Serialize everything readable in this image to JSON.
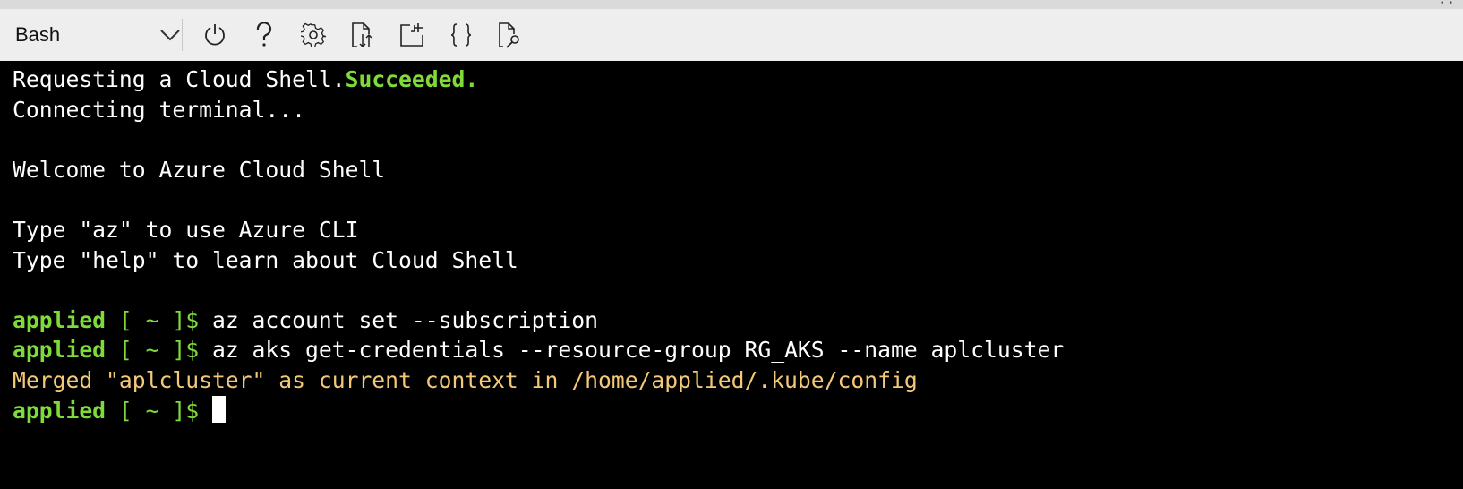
{
  "toolbar": {
    "shell_selector": {
      "selected": "Bash"
    },
    "buttons": [
      {
        "name": "restart",
        "icon": "power-icon"
      },
      {
        "name": "help",
        "icon": "question-icon"
      },
      {
        "name": "settings",
        "icon": "gear-icon"
      },
      {
        "name": "upload-download",
        "icon": "file-transfer-icon"
      },
      {
        "name": "new-session",
        "icon": "new-window-icon"
      },
      {
        "name": "editor",
        "icon": "braces-icon"
      },
      {
        "name": "web-preview",
        "icon": "file-search-icon"
      }
    ]
  },
  "terminal": {
    "colors": {
      "prompt": "#7ddc3a",
      "success": "#7ddc3a",
      "output_info": "#f3c877",
      "text": "#ffffff"
    },
    "line1_text": "Requesting a Cloud Shell.",
    "line1_status": "Succeeded.",
    "line2": "Connecting terminal...",
    "welcome": "Welcome to Azure Cloud Shell",
    "hint_az": "Type \"az\" to use Azure CLI",
    "hint_help": "Type \"help\" to learn about Cloud Shell",
    "prompt_user": "applied",
    "prompt_rest": " [ ~ ]$ ",
    "cmd1": "az account set --subscription",
    "cmd2": "az aks get-credentials --resource-group RG_AKS --name aplcluster",
    "merged_output": "Merged \"aplcluster\" as current context in /home/applied/.kube/config"
  }
}
